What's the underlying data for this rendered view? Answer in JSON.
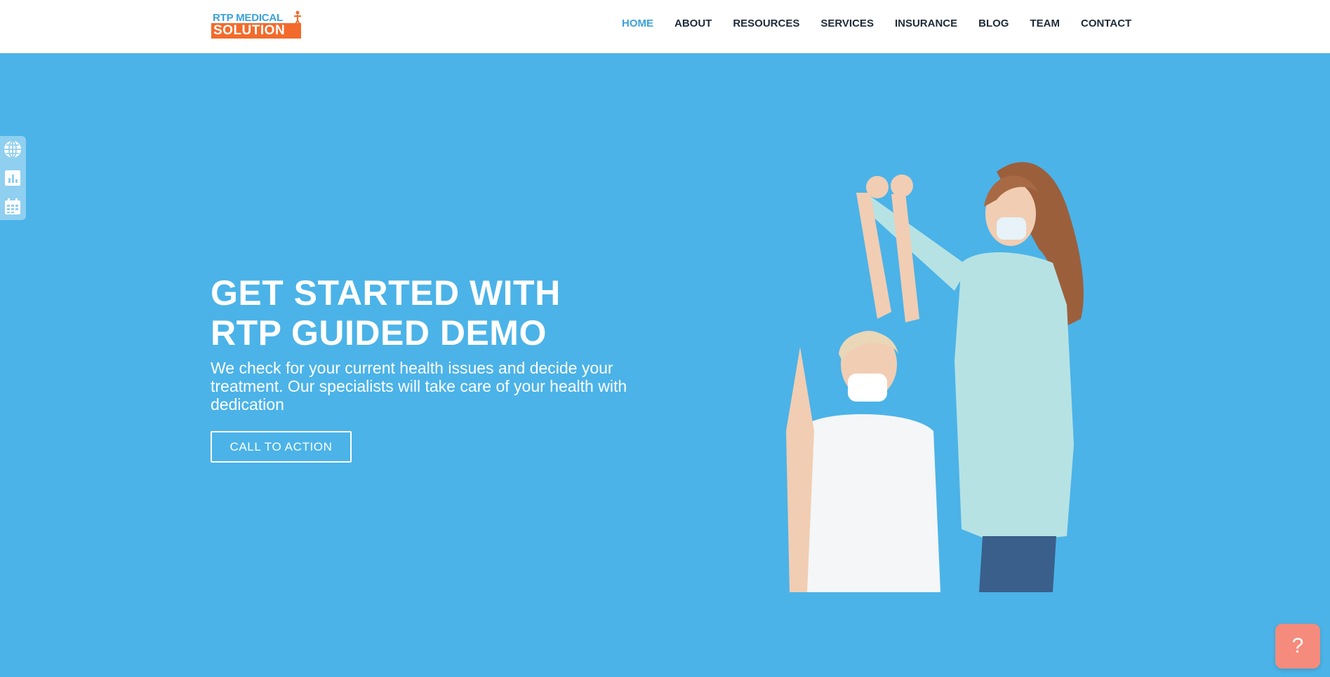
{
  "logo": {
    "line1": "RTP MEDICAL",
    "line2": "SOLUTION"
  },
  "nav": {
    "items": [
      {
        "label": "HOME",
        "active": true
      },
      {
        "label": "ABOUT"
      },
      {
        "label": "RESOURCES"
      },
      {
        "label": "SERVICES"
      },
      {
        "label": "INSURANCE"
      },
      {
        "label": "BLOG"
      },
      {
        "label": "TEAM"
      },
      {
        "label": "CONTACT"
      }
    ]
  },
  "sidebar": {
    "icons": [
      "globe-icon",
      "bar-chart-icon",
      "calendar-icon"
    ]
  },
  "hero": {
    "title_line1": "GET STARTED WITH",
    "title_line2": "RTP GUIDED DEMO",
    "description": "We check for your current health issues and decide your treatment. Our specialists will take care of your health with dedication",
    "cta_label": "CALL TO ACTION"
  },
  "help": {
    "label": "?"
  },
  "colors": {
    "hero_bg": "#4bb3e8",
    "nav_active": "#3aa2da",
    "nav_text": "#1d2b3a",
    "logo_orange": "#f26b2c",
    "help_bg": "#f58b7c"
  }
}
